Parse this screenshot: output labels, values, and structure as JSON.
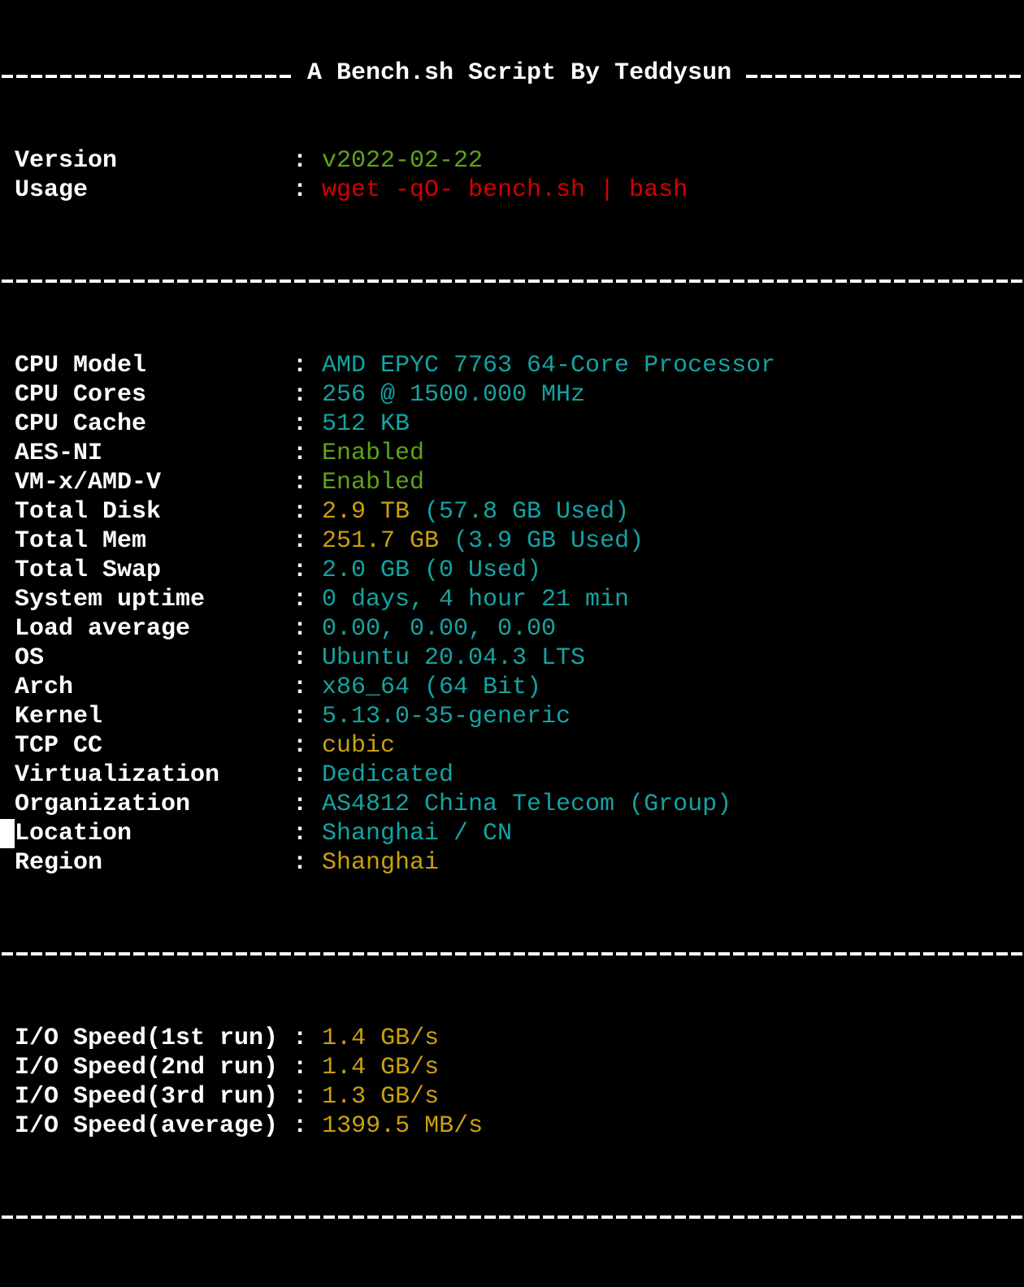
{
  "terminal": {
    "title": "A Bench.sh Script By Teddysun",
    "header_rows": [
      {
        "label": "Version",
        "parts": [
          {
            "text": "v2022-02-22",
            "color": "green"
          }
        ]
      },
      {
        "label": "Usage",
        "parts": [
          {
            "text": "wget -qO- bench.sh | bash",
            "color": "red"
          }
        ]
      }
    ],
    "system_rows": [
      {
        "label": "CPU Model",
        "parts": [
          {
            "text": "AMD EPYC 7763 64-Core Processor",
            "color": "cyan"
          }
        ]
      },
      {
        "label": "CPU Cores",
        "parts": [
          {
            "text": "256 @ 1500.000 MHz",
            "color": "cyan"
          }
        ]
      },
      {
        "label": "CPU Cache",
        "parts": [
          {
            "text": "512 KB",
            "color": "cyan"
          }
        ]
      },
      {
        "label": "AES-NI",
        "parts": [
          {
            "text": "Enabled",
            "color": "green"
          }
        ]
      },
      {
        "label": "VM-x/AMD-V",
        "parts": [
          {
            "text": "Enabled",
            "color": "green"
          }
        ]
      },
      {
        "label": "Total Disk",
        "parts": [
          {
            "text": "2.9 TB",
            "color": "yellow"
          },
          {
            "text": " (57.8 GB Used)",
            "color": "cyan"
          }
        ]
      },
      {
        "label": "Total Mem",
        "parts": [
          {
            "text": "251.7 GB",
            "color": "yellow"
          },
          {
            "text": " (3.9 GB Used)",
            "color": "cyan"
          }
        ]
      },
      {
        "label": "Total Swap",
        "parts": [
          {
            "text": "2.0 GB (0 Used)",
            "color": "cyan"
          }
        ]
      },
      {
        "label": "System uptime",
        "parts": [
          {
            "text": "0 days, 4 hour 21 min",
            "color": "cyan"
          }
        ]
      },
      {
        "label": "Load average",
        "parts": [
          {
            "text": "0.00, 0.00, 0.00",
            "color": "cyan"
          }
        ]
      },
      {
        "label": "OS",
        "parts": [
          {
            "text": "Ubuntu 20.04.3 LTS",
            "color": "cyan"
          }
        ]
      },
      {
        "label": "Arch",
        "parts": [
          {
            "text": "x86_64 (64 Bit)",
            "color": "cyan"
          }
        ]
      },
      {
        "label": "Kernel",
        "parts": [
          {
            "text": "5.13.0-35-generic",
            "color": "cyan"
          }
        ]
      },
      {
        "label": "TCP CC",
        "parts": [
          {
            "text": "cubic",
            "color": "yellow"
          }
        ]
      },
      {
        "label": "Virtualization",
        "parts": [
          {
            "text": "Dedicated",
            "color": "cyan"
          }
        ]
      },
      {
        "label": "Organization",
        "parts": [
          {
            "text": "AS4812 China Telecom (Group)",
            "color": "cyan"
          }
        ]
      },
      {
        "label": "Location",
        "parts": [
          {
            "text": "Shanghai / CN",
            "color": "cyan"
          }
        ]
      },
      {
        "label": "Region",
        "parts": [
          {
            "text": "Shanghai",
            "color": "yellow"
          }
        ]
      }
    ],
    "io_rows": [
      {
        "label": "I/O Speed(1st run)",
        "parts": [
          {
            "text": "1.4 GB/s",
            "color": "yellow"
          }
        ]
      },
      {
        "label": "I/O Speed(2nd run)",
        "parts": [
          {
            "text": "1.4 GB/s",
            "color": "yellow"
          }
        ]
      },
      {
        "label": "I/O Speed(3rd run)",
        "parts": [
          {
            "text": "1.3 GB/s",
            "color": "yellow"
          }
        ]
      },
      {
        "label": "I/O Speed(average)",
        "parts": [
          {
            "text": "1399.5 MB/s",
            "color": "yellow"
          }
        ]
      }
    ],
    "colon": ":",
    "colors": {
      "background": "#000000",
      "text": "#ffffff",
      "green": "#5fa31a",
      "red": "#d40000",
      "cyan": "#15a2a2",
      "yellow": "#c9a00e"
    }
  }
}
